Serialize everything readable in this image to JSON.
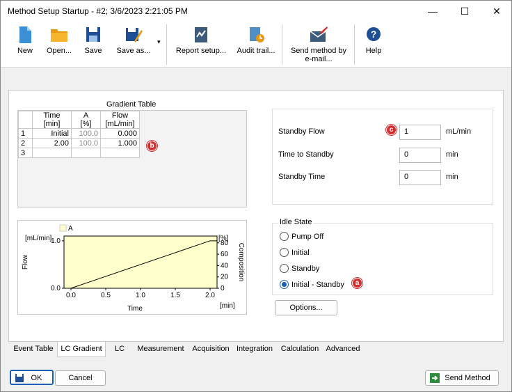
{
  "window": {
    "title": "Method Setup Startup - #2;  3/6/2023   2:21:05 PM",
    "minimize": "—",
    "maximize": "☐",
    "close": "✕"
  },
  "toolbar": {
    "new": "New",
    "open": "Open...",
    "save": "Save",
    "save_as": "Save as...",
    "report_setup": "Report setup...",
    "audit_trail": "Audit trail...",
    "send_email_line1": "Send method by",
    "send_email_line2": "e-mail...",
    "help": "Help",
    "dropdown_arrow": "▾"
  },
  "gradient": {
    "title": "Gradient Table",
    "headers": [
      {
        "line1": "Time",
        "line2": "[min]"
      },
      {
        "line1": "A",
        "line2": "[%]"
      },
      {
        "line1": "Flow",
        "line2": "[mL/min]"
      }
    ],
    "rows": [
      {
        "n": "1",
        "time": "Initial",
        "a": "100.0",
        "flow": "0.000"
      },
      {
        "n": "2",
        "time": "2.00",
        "a": "100.0",
        "flow": "1.000"
      },
      {
        "n": "3",
        "time": "",
        "a": "",
        "flow": ""
      }
    ],
    "callout_b": "b"
  },
  "chart_data": {
    "type": "line",
    "title": "",
    "legend": [
      "A"
    ],
    "left_unit": "[mL/min]",
    "right_unit": "[%]",
    "xlabel": "Time",
    "x_unit": "[min]",
    "ylabel_left": "Flow",
    "ylabel_right": "Composition",
    "x_ticks": [
      "0.0",
      "0.5",
      "1.0",
      "1.5",
      "2.0"
    ],
    "y_left_ticks": [
      "0.0",
      "1.0"
    ],
    "y_right_ticks": [
      "0",
      "20",
      "40",
      "60",
      "80"
    ],
    "xlim": [
      -0.1,
      2.1
    ],
    "ylim_left": [
      0,
      1.1
    ],
    "ylim_right": [
      0,
      92
    ],
    "flow_series": {
      "x": [
        0.0,
        2.0,
        2.1
      ],
      "y": [
        0.0,
        1.0,
        1.0
      ]
    },
    "composition_series": {
      "x": [
        0.0,
        2.1
      ],
      "y": [
        100,
        100
      ]
    },
    "colors": {
      "fill": "#ffffcc",
      "line": "#000000"
    }
  },
  "standby": {
    "flow_label": "Standby Flow",
    "flow_value": "1",
    "flow_unit": "mL/min",
    "time_to_label": "Time to Standby",
    "time_to_value": "0",
    "time_to_unit": "min",
    "time_label": "Standby Time",
    "time_value": "0",
    "time_unit": "min",
    "callout_c": "c"
  },
  "idle": {
    "legend": "Idle State",
    "options": [
      "Pump Off",
      "Initial",
      "Standby",
      "Initial - Standby"
    ],
    "selected_index": 3,
    "callout_a": "a",
    "options_button": "Options..."
  },
  "tabs": [
    "Event Table",
    "LC Gradient",
    "LC",
    "Measurement",
    "Acquisition",
    "Integration",
    "Calculation",
    "Advanced"
  ],
  "active_tab": "LC Gradient",
  "footer": {
    "ok": "OK",
    "cancel": "Cancel",
    "send_method": "Send Method"
  }
}
